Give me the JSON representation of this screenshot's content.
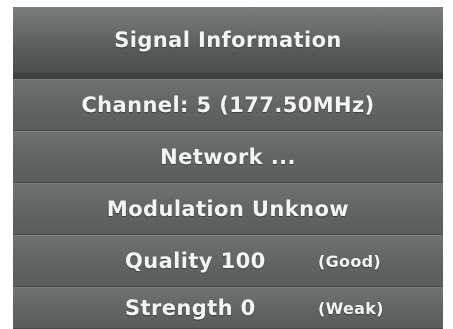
{
  "title": "Signal Information",
  "channel": "Channel: 5 (177.50MHz)",
  "network": "Network ...",
  "modulation": "Modulation Unknow",
  "quality": {
    "label": "Quality 100",
    "state": "(Good)"
  },
  "strength": {
    "label": "Strength 0",
    "state": "(Weak)"
  },
  "colors": {
    "panel": "#5f6361",
    "text": "#f4f4f4"
  }
}
